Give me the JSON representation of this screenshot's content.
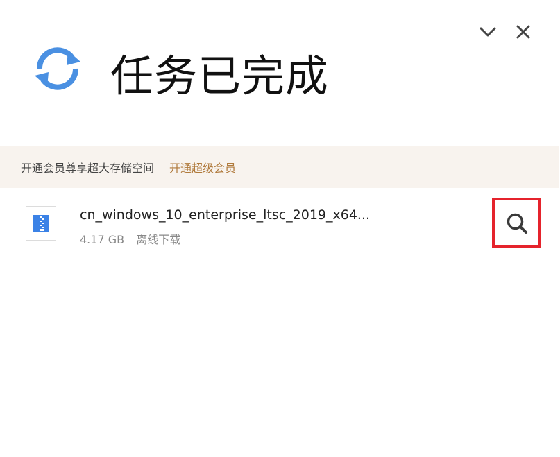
{
  "header": {
    "title": "任务已完成",
    "sync_icon": "sync-refresh-icon",
    "collapse_icon": "chevron-down-icon",
    "close_icon": "close-icon",
    "accent_color": "#4a90e2"
  },
  "promo": {
    "text": "开通会员尊享超大存储空间",
    "link_label": "开通超级会员",
    "background_color": "#f8f3ee",
    "link_color": "#b07a3c"
  },
  "file": {
    "name": "cn_windows_10_enterprise_ltsc_2019_x64...",
    "size": "4.17 GB",
    "status": "离线下载",
    "icon": "zip-file-icon",
    "action_icon": "search-icon",
    "highlight_color": "#e5232c"
  }
}
